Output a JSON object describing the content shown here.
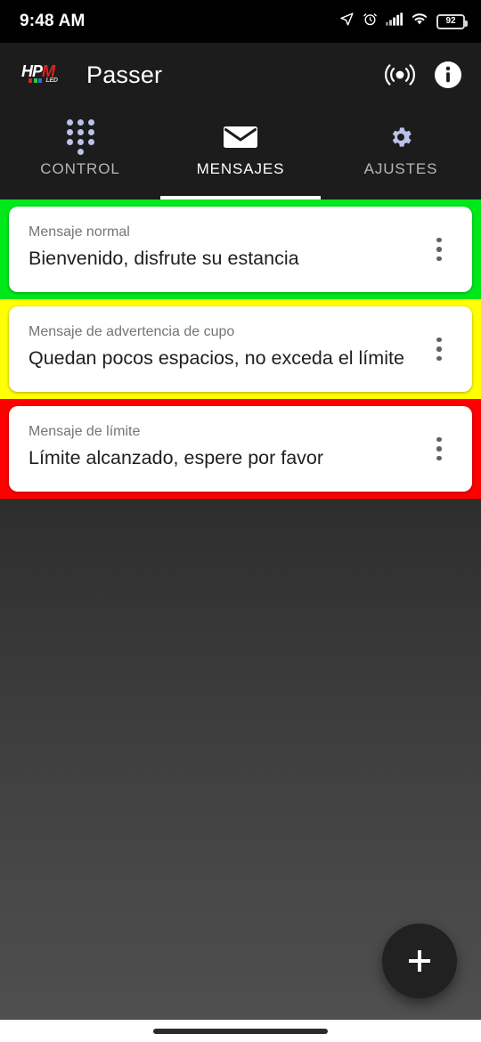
{
  "status_bar": {
    "time": "9:48 AM",
    "battery_level": "92",
    "icons": [
      "location-arrow-icon",
      "alarm-icon",
      "cellular-signal-icon",
      "wifi-icon",
      "battery-icon"
    ]
  },
  "app_bar": {
    "logo_text": "HPM",
    "logo_sub_text": "LED",
    "title": "Passer",
    "broadcast_label": "broadcast-icon",
    "info_label": "info-icon"
  },
  "tabs": {
    "active_index": 1,
    "items": [
      {
        "label": "CONTROL",
        "icon": "dialpad-icon"
      },
      {
        "label": "MENSAJES",
        "icon": "envelope-icon"
      },
      {
        "label": "AJUSTES",
        "icon": "gear-icon"
      }
    ]
  },
  "messages": [
    {
      "label": "Mensaje normal",
      "text": "Bienvenido, disfrute su estancia",
      "band_color": "#00e81a",
      "menu": "overflow-menu-icon"
    },
    {
      "label": "Mensaje de advertencia de cupo",
      "text": "Quedan pocos espacios, no exceda el límite",
      "band_color": "#ffff00",
      "menu": "overflow-menu-icon"
    },
    {
      "label": "Mensaje de límite",
      "text": "Límite alcanzado, espere por favor",
      "band_color": "#ff0000",
      "menu": "overflow-menu-icon"
    }
  ],
  "fab": {
    "label": "+",
    "name": "add-message-button"
  },
  "colors": {
    "accent_tab_icon": "#b9c3e8",
    "card_background": "#ffffff",
    "app_bar_background": "#1c1c1c",
    "card_label_text": "#757575",
    "card_body_text": "#1f1f1f"
  },
  "nav_bar": {
    "gesture_pill": "home-gesture-pill"
  }
}
